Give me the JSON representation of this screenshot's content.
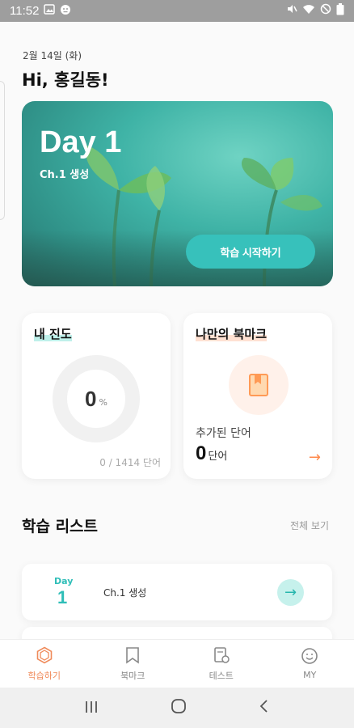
{
  "status_bar": {
    "time": "11:52",
    "left_icons": [
      "image-icon",
      "alarm-icon"
    ],
    "right_icons": [
      "mute-icon",
      "wifi-icon",
      "dnd-icon",
      "battery-icon"
    ]
  },
  "header": {
    "date": "2월 14일 (화)",
    "greeting": "Hi, 홍길동!"
  },
  "hero": {
    "day_title": "Day 1",
    "chapter": "Ch.1 생성",
    "start_button": "학습 시작하기",
    "accent": "#37c1bb"
  },
  "progress_card": {
    "title": "내 진도",
    "percent_value": "0",
    "percent_unit": "%",
    "progress_fraction": 0,
    "count_text": "0 / 1414 단어"
  },
  "bookmark_card": {
    "title": "나만의 북마크",
    "added_label": "추가된 단어",
    "count": "0",
    "count_unit": "단어",
    "icon": "bookmark-book-icon",
    "accent": "#ff8a4c"
  },
  "study_list": {
    "title": "학습 리스트",
    "view_all": "전체 보기",
    "items": [
      {
        "day_label": "Day",
        "day_number": "1",
        "name": "Ch.1 생성"
      }
    ]
  },
  "tab_bar": {
    "tabs": [
      {
        "label": "학습하기",
        "icon": "study-hexagon-icon",
        "active": true
      },
      {
        "label": "북마크",
        "icon": "bookmark-icon",
        "active": false
      },
      {
        "label": "테스트",
        "icon": "test-doc-icon",
        "active": false
      },
      {
        "label": "MY",
        "icon": "smile-icon",
        "active": false
      }
    ],
    "active_color": "#f08a5a"
  },
  "nav_bar": {
    "buttons": [
      "recents-icon",
      "home-icon",
      "back-icon"
    ]
  }
}
